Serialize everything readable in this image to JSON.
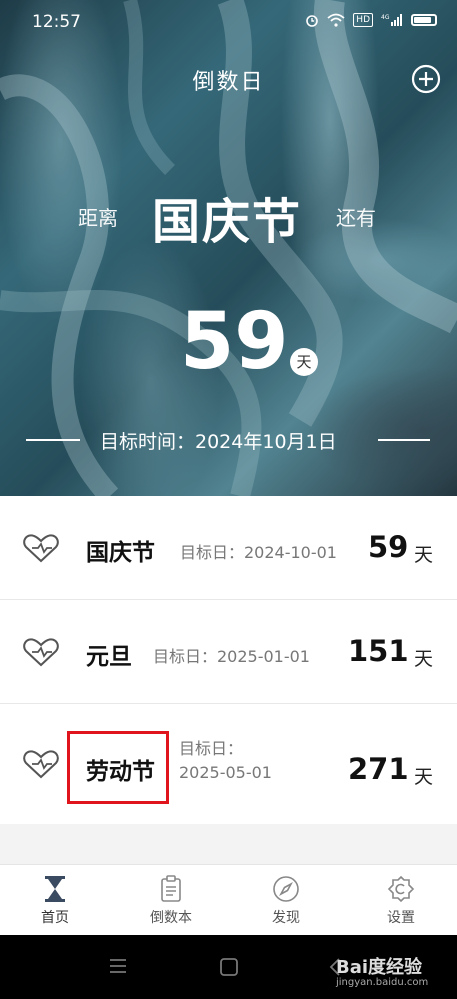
{
  "status_bar": {
    "time": "12:57",
    "hd_label": "HD",
    "network_label": "4G"
  },
  "header": {
    "title": "倒数日"
  },
  "hero": {
    "distance_label": "距离",
    "event_name": "国庆节",
    "remain_label": "还有",
    "count": "59",
    "unit": "天",
    "target_text": "目标时间：2024年10月1日"
  },
  "events": [
    {
      "name": "国庆节",
      "date_label": "目标日：2024-10-01",
      "days": "59",
      "unit": "天"
    },
    {
      "name": "元旦",
      "date_label": "目标日：2025-01-01",
      "days": "151",
      "unit": "天"
    },
    {
      "name": "劳动节",
      "date_label_line1": "目标日：",
      "date_label_line2": "2025-05-01",
      "days": "271",
      "unit": "天"
    }
  ],
  "tabs": [
    {
      "label": "首页",
      "icon": "hourglass-icon",
      "active": true
    },
    {
      "label": "倒数本",
      "icon": "clipboard-icon",
      "active": false
    },
    {
      "label": "发现",
      "icon": "compass-icon",
      "active": false
    },
    {
      "label": "设置",
      "icon": "settings-icon",
      "active": false
    }
  ],
  "watermark": {
    "main": "Bai度经验",
    "sub": "jingyan.baidu.com"
  },
  "colors": {
    "highlight": "#e0141c",
    "hero_base": "#3d7585"
  }
}
